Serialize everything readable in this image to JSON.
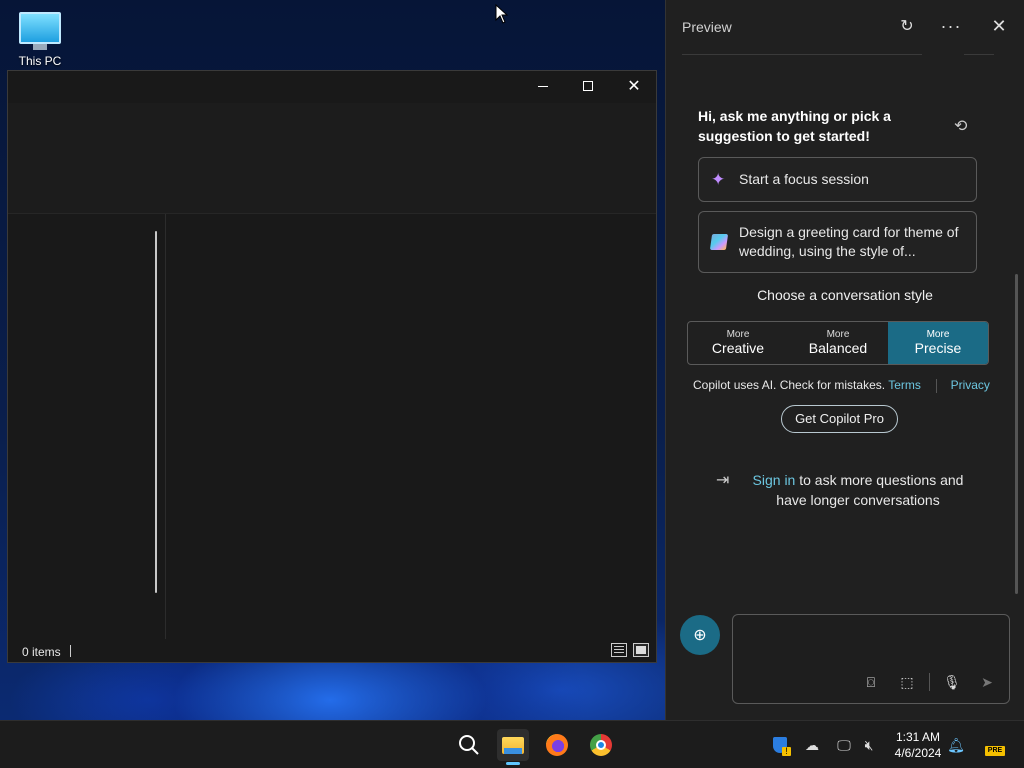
{
  "desktop": {
    "icon_label": "This PC"
  },
  "explorer": {
    "status_count": "0 items"
  },
  "copilot": {
    "title": "Preview",
    "greeting": "Hi, ask me anything or pick a suggestion to get started!",
    "suggestions": [
      {
        "text": "Start a focus session",
        "icon": "sparkle-icon"
      },
      {
        "text": "Design a greeting card for theme of wedding, using the style of...",
        "icon": "pencil-icon"
      }
    ],
    "style_heading": "Choose a conversation style",
    "styles": [
      {
        "small": "More",
        "big": "Creative",
        "active": false
      },
      {
        "small": "More",
        "big": "Balanced",
        "active": false
      },
      {
        "small": "More",
        "big": "Precise",
        "active": true
      }
    ],
    "disclaimer": "Copilot uses AI. Check for mistakes.",
    "terms_link": "Terms",
    "privacy_link": "Privacy",
    "pro_button": "Get Copilot Pro",
    "signin_link": "Sign in",
    "signin_rest": " to ask more questions and have longer conversations",
    "accent_color": "#1b6b86"
  },
  "taskbar": {
    "time": "1:31 AM",
    "date": "4/6/2024",
    "pre_badge": "PRE"
  }
}
